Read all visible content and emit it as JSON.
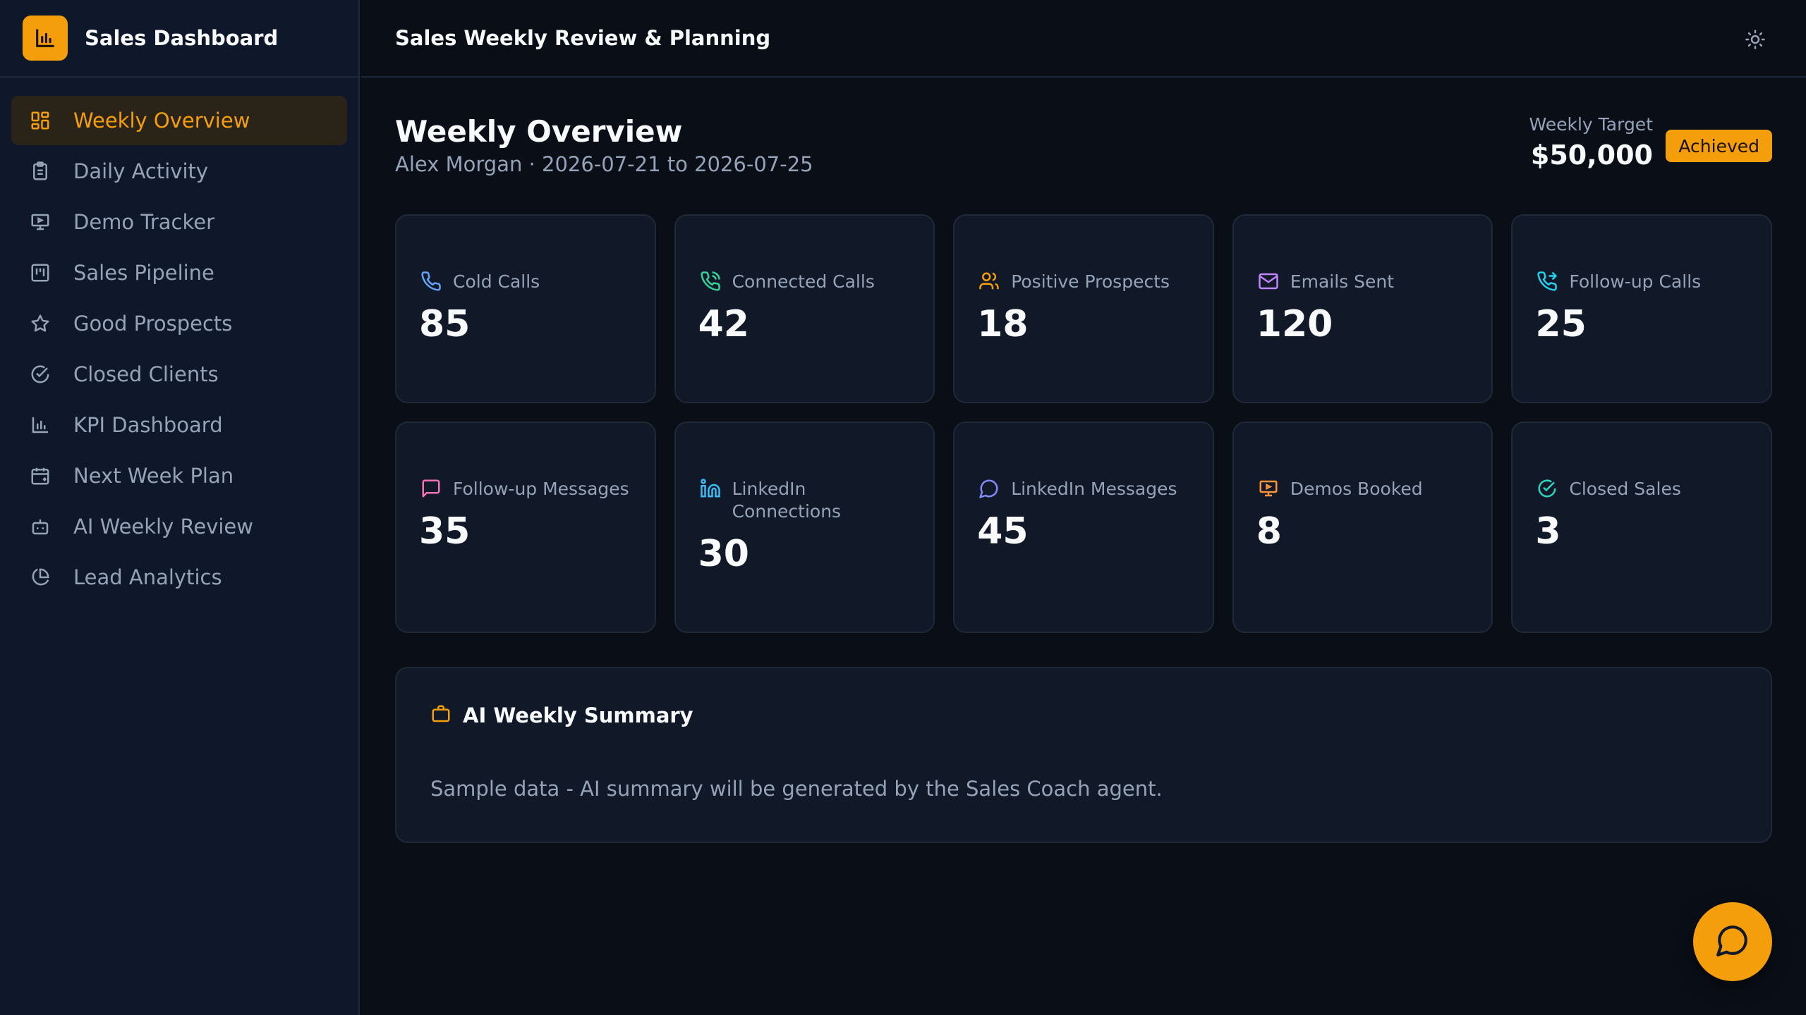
{
  "app": {
    "title": "Sales Dashboard",
    "accent": "#f59e0b"
  },
  "sidebar": {
    "items": [
      {
        "label": "Weekly Overview",
        "icon": "grid-icon",
        "active": true
      },
      {
        "label": "Daily Activity",
        "icon": "clipboard-icon"
      },
      {
        "label": "Demo Tracker",
        "icon": "presentation-icon"
      },
      {
        "label": "Sales Pipeline",
        "icon": "kanban-icon"
      },
      {
        "label": "Good Prospects",
        "icon": "star-icon"
      },
      {
        "label": "Closed Clients",
        "icon": "check-circle-icon"
      },
      {
        "label": "KPI Dashboard",
        "icon": "bar-chart-icon"
      },
      {
        "label": "Next Week Plan",
        "icon": "calendar-icon"
      },
      {
        "label": "AI Weekly Review",
        "icon": "bot-icon"
      },
      {
        "label": "Lead Analytics",
        "icon": "pie-chart-icon"
      }
    ]
  },
  "header": {
    "title": "Sales Weekly Review & Planning",
    "theme_icon": "sun-icon"
  },
  "main": {
    "title": "Weekly Overview",
    "subtitle": "Alex Morgan · 2026-07-21 to 2026-07-25",
    "target_label": "Weekly Target",
    "target_value": "$50,000",
    "badge": "Achieved"
  },
  "metrics": [
    {
      "label": "Cold Calls",
      "value": "85",
      "icon": "phone-icon",
      "color": "#60a5fa"
    },
    {
      "label": "Connected Calls",
      "value": "42",
      "icon": "phone-call-icon",
      "color": "#34d399"
    },
    {
      "label": "Positive Prospects",
      "value": "18",
      "icon": "users-icon",
      "color": "#f59e0b"
    },
    {
      "label": "Emails Sent",
      "value": "120",
      "icon": "mail-icon",
      "color": "#c084fc"
    },
    {
      "label": "Follow-up Calls",
      "value": "25",
      "icon": "phone-forwarded-icon",
      "color": "#22d3ee"
    },
    {
      "label": "Follow-up Messages",
      "value": "35",
      "icon": "message-square-icon",
      "color": "#f472b6"
    },
    {
      "label": "LinkedIn Connections",
      "value": "30",
      "icon": "linkedin-icon",
      "color": "#38bdf8"
    },
    {
      "label": "LinkedIn Messages",
      "value": "45",
      "icon": "message-circle-icon",
      "color": "#818cf8"
    },
    {
      "label": "Demos Booked",
      "value": "8",
      "icon": "presentation-icon",
      "color": "#fb923c"
    },
    {
      "label": "Closed Sales",
      "value": "3",
      "icon": "check-circle-icon",
      "color": "#2dd4bf"
    }
  ],
  "summary": {
    "title": "AI Weekly Summary",
    "icon": "briefcase-icon",
    "text": "Sample data - AI summary will be generated by the Sales Coach agent."
  },
  "chat": {
    "icon": "message-circle-icon"
  }
}
